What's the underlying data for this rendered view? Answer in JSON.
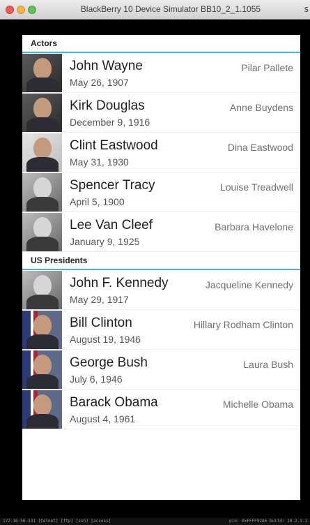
{
  "window": {
    "title": "BlackBerry 10 Device Simulator BB10_2_1.1055",
    "title_overflow": "s"
  },
  "sections": [
    {
      "header": "Actors",
      "rows": [
        {
          "name": "John Wayne",
          "date": "May 26, 1907",
          "spouse": "Pilar Pallete"
        },
        {
          "name": "Kirk Douglas",
          "date": "December 9, 1916",
          "spouse": "Anne Buydens"
        },
        {
          "name": "Clint Eastwood",
          "date": "May 31, 1930",
          "spouse": "Dina Eastwood"
        },
        {
          "name": "Spencer Tracy",
          "date": "April 5, 1900",
          "spouse": "Louise Treadwell"
        },
        {
          "name": "Lee Van Cleef",
          "date": "January 9, 1925",
          "spouse": "Barbara Havelone"
        }
      ]
    },
    {
      "header": "US Presidents",
      "rows": [
        {
          "name": "John F. Kennedy",
          "date": "May 29, 1917",
          "spouse": "Jacqueline Kennedy"
        },
        {
          "name": "Bill Clinton",
          "date": "August 19, 1946",
          "spouse": "Hillary Rodham Clinton"
        },
        {
          "name": "George Bush",
          "date": "July 6, 1946",
          "spouse": "Laura Bush"
        },
        {
          "name": "Barack Obama",
          "date": "August 4, 1961",
          "spouse": "Michelle Obama"
        }
      ]
    }
  ],
  "status": {
    "left": "172.16.56.131     [telnet]  [ftp]  [ssh]  [access]",
    "right": "pin: 0xFFFF92A6    build: 10.2.1.1"
  },
  "colors": {
    "accent": "#49b2df",
    "background": "#000000",
    "list_background": "#ffffff"
  }
}
